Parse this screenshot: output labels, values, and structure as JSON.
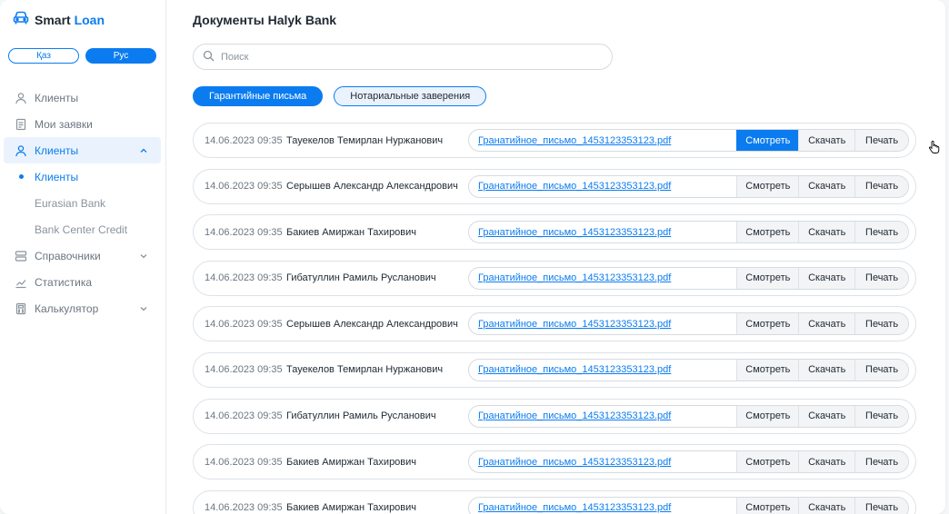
{
  "app": {
    "logo_prefix": "Smart",
    "logo_accent": "Loan",
    "brand_color": "#0b7cf0"
  },
  "lang": {
    "kaz": "Қаз",
    "rus": "Рус",
    "active": "Рус"
  },
  "sidebar": {
    "items": [
      {
        "label": "Клиенты",
        "icon": "user-icon"
      },
      {
        "label": "Мои заявки",
        "icon": "document-icon"
      },
      {
        "label": "Клиенты",
        "icon": "user-icon",
        "active": true,
        "expanded": true
      },
      {
        "label": "Справочники",
        "icon": "list-icon"
      },
      {
        "label": "Статистика",
        "icon": "chart-icon"
      },
      {
        "label": "Калькулятор",
        "icon": "calculator-icon"
      }
    ],
    "subitems": [
      {
        "label": "Клиенты",
        "active": true
      },
      {
        "label": "Eurasian Bank"
      },
      {
        "label": "Bank Center Credit"
      }
    ]
  },
  "main": {
    "title": "Документы Halyk Bank",
    "search_placeholder": "Поиск",
    "tabs": [
      {
        "label": "Гарантийные письма",
        "active": true
      },
      {
        "label": "Нотариальные заверения",
        "active": false
      }
    ],
    "actions": {
      "view": "Смотреть",
      "download": "Скачать",
      "print": "Печать"
    },
    "rows": [
      {
        "date": "14.06.2023 09:35",
        "name": "Тауекелов Темирлан Нуржанович",
        "file": "Гранатийное_письмо_1453123353123.pdf",
        "view_hover": true
      },
      {
        "date": "14.06.2023 09:35",
        "name": "Серышев Александр Александрович",
        "file": "Гранатийное_письмо_1453123353123.pdf"
      },
      {
        "date": "14.06.2023 09:35",
        "name": "Бакиев Амиржан Тахирович",
        "file": "Гранатийное_письмо_1453123353123.pdf"
      },
      {
        "date": "14.06.2023 09:35",
        "name": "Гибатуллин Рамиль Русланович",
        "file": "Гранатийное_письмо_1453123353123.pdf"
      },
      {
        "date": "14.06.2023 09:35",
        "name": "Серышев Александр Александрович",
        "file": "Гранатийное_письмо_1453123353123.pdf"
      },
      {
        "date": "14.06.2023 09:35",
        "name": "Тауекелов Темирлан Нуржанович",
        "file": "Гранатийное_письмо_1453123353123.pdf"
      },
      {
        "date": "14.06.2023 09:35",
        "name": "Гибатуллин Рамиль Русланович",
        "file": "Гранатийное_письмо_1453123353123.pdf"
      },
      {
        "date": "14.06.2023 09:35",
        "name": "Бакиев Амиржан Тахирович",
        "file": "Гранатийное_письмо_1453123353123.pdf"
      },
      {
        "date": "14.06.2023 09:35",
        "name": "Бакиев Амиржан Тахирович",
        "file": "Гранатийное_письмо_1453123353123.pdf"
      }
    ]
  }
}
